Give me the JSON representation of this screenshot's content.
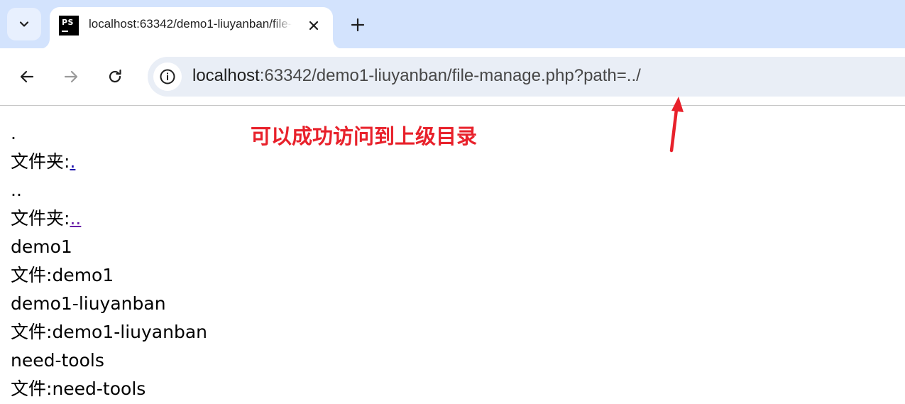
{
  "browser": {
    "tab": {
      "favicon_text": "PS",
      "title": "localhost:63342/demo1-liuyanban/file-manage.php?path=../"
    },
    "address_bar": {
      "host": "localhost",
      "rest": ":63342/demo1-liuyanban/file-manage.php?path=../"
    }
  },
  "icons": {
    "tab_search": "chevron-down-icon",
    "close": "close-icon",
    "new_tab": "plus-icon",
    "back": "arrow-left-icon",
    "forward": "arrow-right-icon",
    "reload": "reload-icon",
    "site_info": "info-icon"
  },
  "colors": {
    "tabstrip": "#d3e3fd",
    "omnibox": "#e9eef6",
    "annotation": "#e8212b",
    "link": "#1a0dab",
    "visited_link": "#681da8"
  },
  "page": {
    "entries": [
      {
        "name": ".",
        "kind_label": "文件夹:",
        "link": "."
      },
      {
        "name": "..",
        "kind_label": "文件夹:",
        "link": ".."
      },
      {
        "name": "demo1",
        "kind_label": "文件:",
        "value": "demo1"
      },
      {
        "name": "demo1-liuyanban",
        "kind_label": "文件:",
        "value": "demo1-liuyanban"
      },
      {
        "name": "need-tools",
        "kind_label": "文件:",
        "value": "need-tools"
      }
    ]
  },
  "annotation": {
    "text": "可以成功访问到上级目录"
  }
}
